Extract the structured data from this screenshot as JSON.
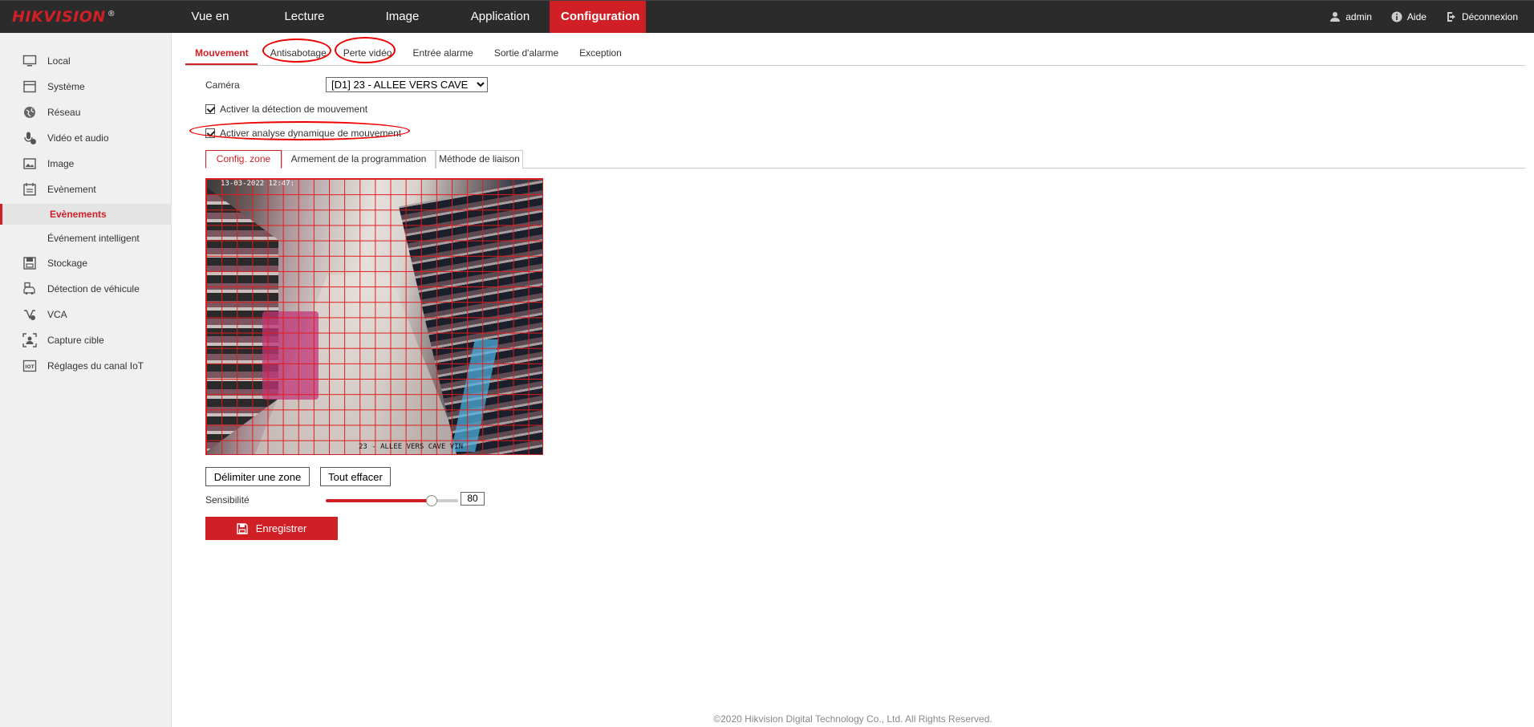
{
  "header": {
    "logo": "HIKVISION",
    "logo_mark": "®",
    "nav": [
      {
        "label": "Vue en direct"
      },
      {
        "label": "Lecture"
      },
      {
        "label": "Image"
      },
      {
        "label": "Application"
      },
      {
        "label": "Configuration",
        "active": true
      }
    ],
    "user": "admin",
    "help": "Aide",
    "logout": "Déconnexion"
  },
  "sidebar": {
    "items": [
      {
        "label": "Local",
        "icon": "monitor-icon"
      },
      {
        "label": "Système",
        "icon": "system-icon"
      },
      {
        "label": "Réseau",
        "icon": "network-icon"
      },
      {
        "label": "Vidéo et audio",
        "icon": "video-audio-icon"
      },
      {
        "label": "Image",
        "icon": "image-icon"
      },
      {
        "label": "Evènement",
        "icon": "event-icon"
      },
      {
        "label": "Evènements",
        "sub": true,
        "active": true
      },
      {
        "label": "Événement intelligent",
        "sub": true
      },
      {
        "label": "Stockage",
        "icon": "storage-icon"
      },
      {
        "label": "Détection de véhicule",
        "icon": "vehicle-detection-icon"
      },
      {
        "label": "VCA",
        "icon": "vca-icon"
      },
      {
        "label": "Capture cible",
        "icon": "target-capture-icon"
      },
      {
        "label": "Réglages du canal IoT",
        "icon": "iot-icon"
      }
    ]
  },
  "tabs": [
    {
      "label": "Mouvement",
      "active": true
    },
    {
      "label": "Antisabotage",
      "circled": true
    },
    {
      "label": "Perte vidéo",
      "circled": true
    },
    {
      "label": "Entrée alarme"
    },
    {
      "label": "Sortie d'alarme"
    },
    {
      "label": "Exception"
    }
  ],
  "form": {
    "camera_label": "Caméra",
    "camera_value": "[D1] 23 - ALLEE VERS CAVE",
    "enable_motion": "Activer la détection de mouvement",
    "enable_dynamic": "Activer analyse dynamique de mouvement",
    "subtabs": [
      {
        "label": "Config. zone",
        "active": true
      },
      {
        "label": "Armement de la programmation"
      },
      {
        "label": "Méthode de liaison"
      }
    ],
    "video_timestamp": "13-03-2022 12:47:  ",
    "video_camname": "23 - ALLEE VERS CAVE VIN",
    "draw_area_button": "Délimiter une zone",
    "clear_all_button": "Tout effacer",
    "sensitivity_label": "Sensibilité",
    "sensitivity_value": "80",
    "sensitivity_fraction": 0.8,
    "save_button": "Enregistrer"
  },
  "footer": "©2020 Hikvision Digital Technology Co., Ltd. All Rights Reserved.",
  "colors": {
    "accent": "#d11f26",
    "topbar": "#2b2b2b",
    "sidebar": "#f0f0f0"
  }
}
